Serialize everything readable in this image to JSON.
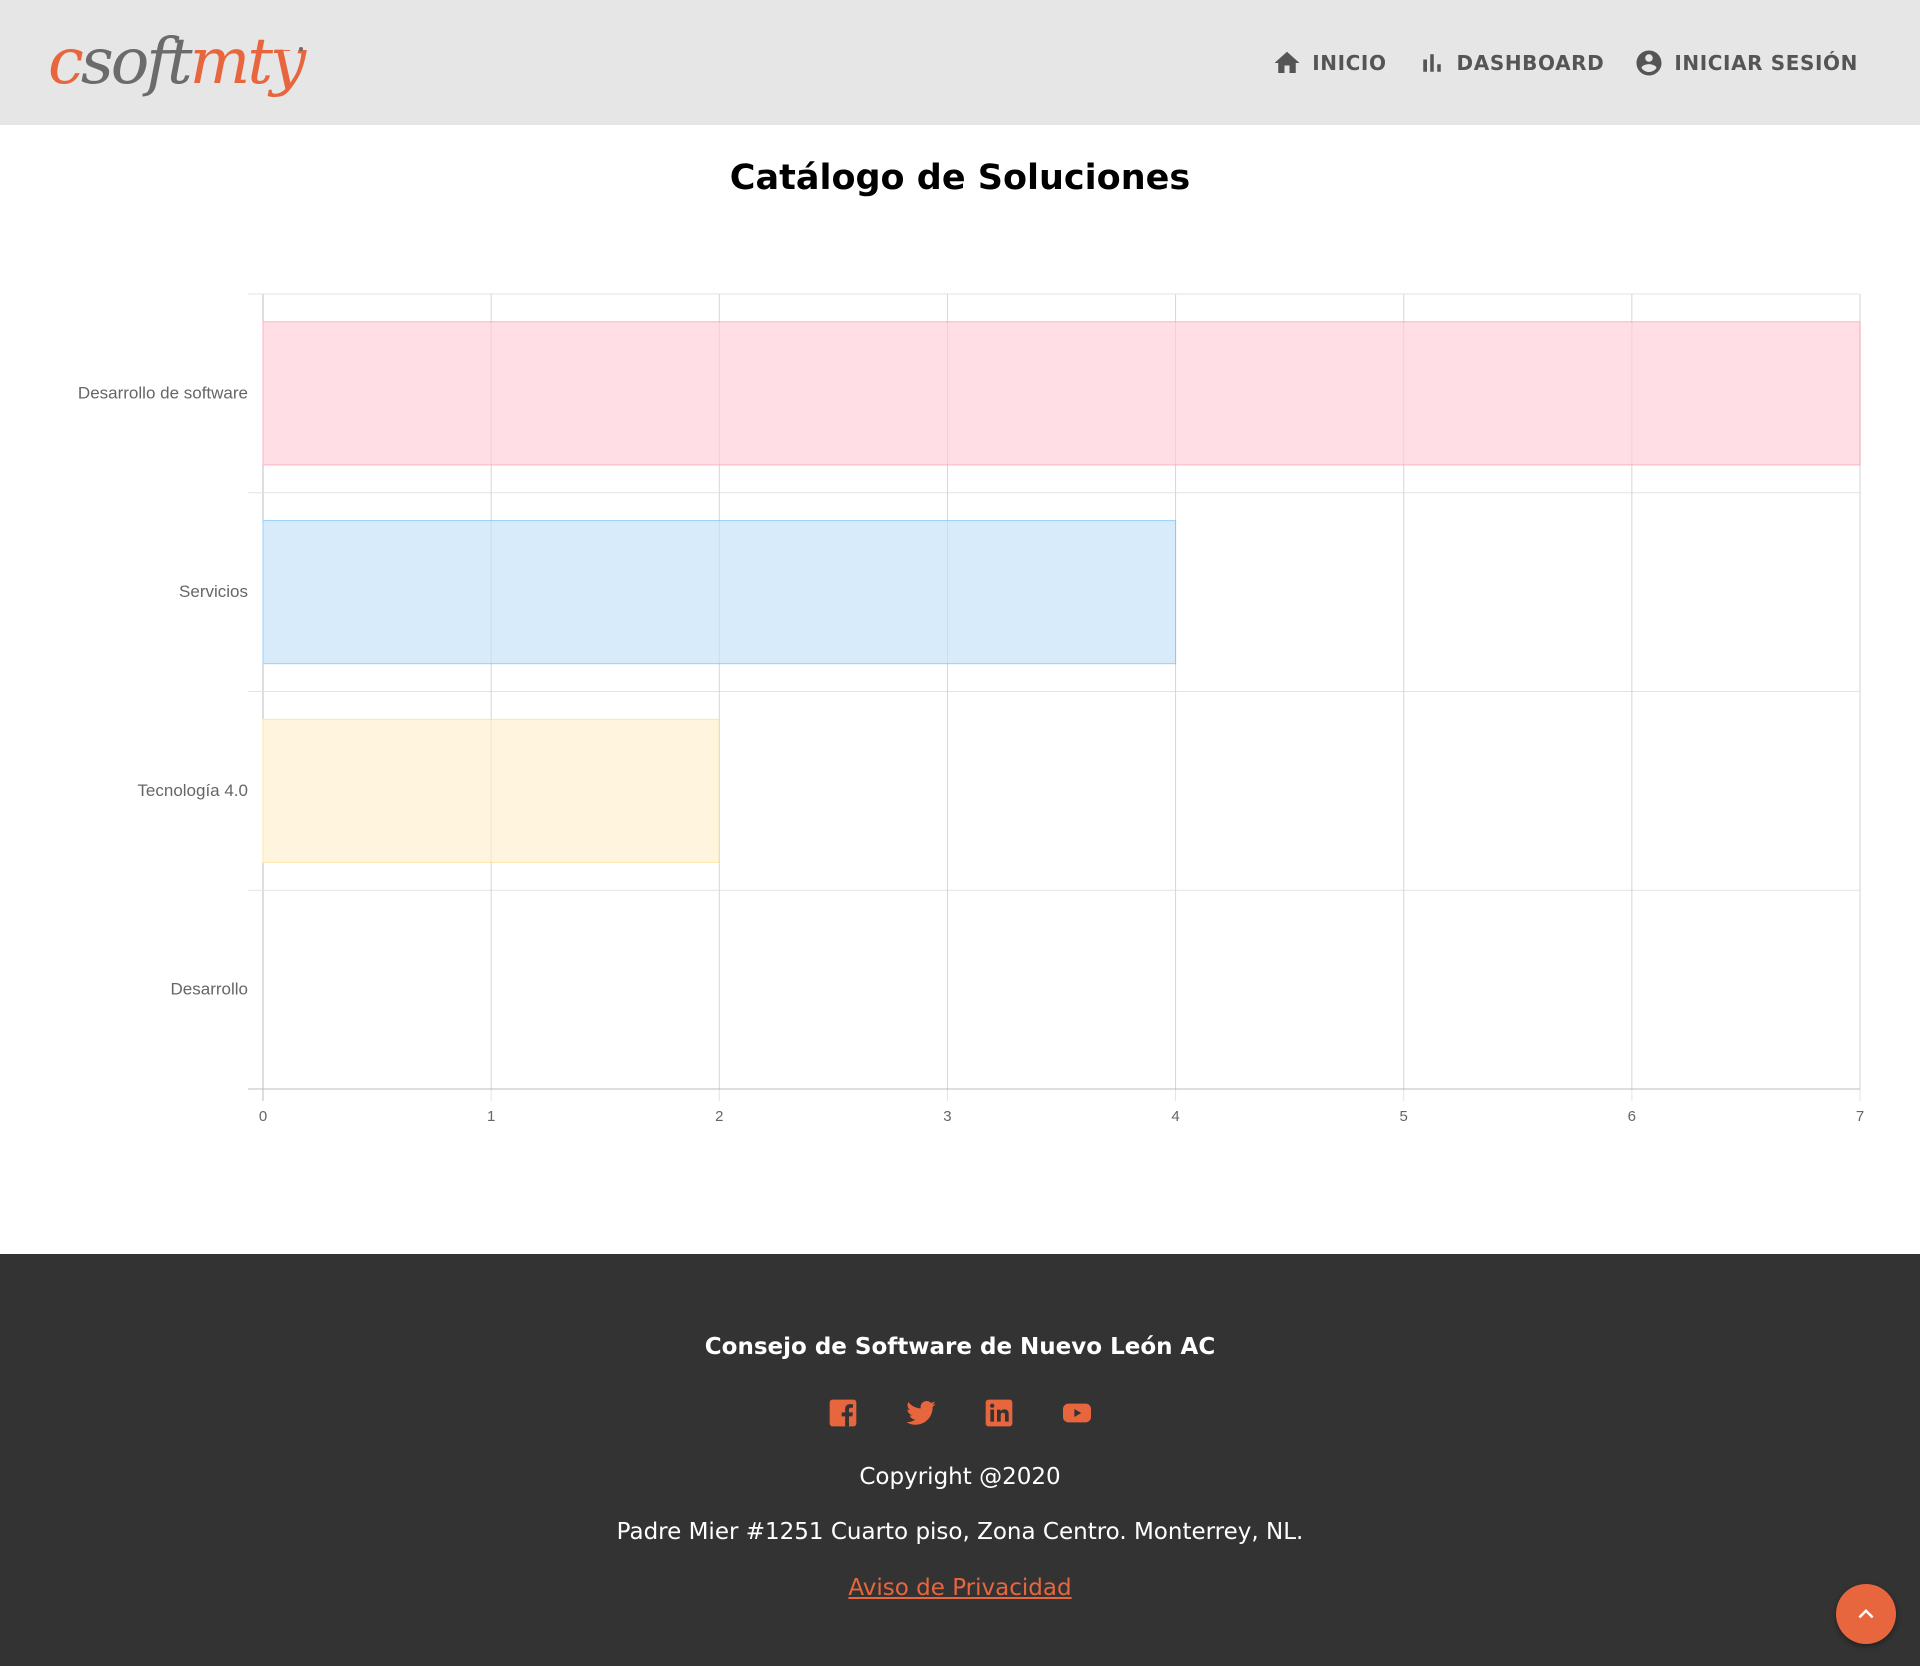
{
  "header": {
    "logo": {
      "c": "c",
      "soft": "soft",
      "mty": "mty"
    },
    "nav": [
      {
        "label": "INICIO",
        "icon": "home-icon"
      },
      {
        "label": "DASHBOARD",
        "icon": "bar-chart-icon"
      },
      {
        "label": "INICIAR SESIÓN",
        "icon": "account-circle-icon"
      }
    ]
  },
  "main": {
    "title": "Catálogo de Soluciones"
  },
  "chart_data": {
    "type": "bar",
    "orientation": "horizontal",
    "categories": [
      "Desarrollo de software",
      "Servicios",
      "Tecnología 4.0",
      "Desarrollo"
    ],
    "values": [
      7,
      4,
      2,
      0
    ],
    "colors": [
      "#ffdee5",
      "#d7ebfa",
      "#fff4dd",
      "#e6f7f7"
    ],
    "border_colors": [
      "#ffb1c1",
      "#9ad0f5",
      "#ffe6aa",
      "#a4dfdf"
    ],
    "xlim": [
      0,
      7
    ],
    "xticks": [
      "0",
      "1",
      "2",
      "3",
      "4",
      "5",
      "6",
      "7"
    ],
    "title": "",
    "xlabel": "",
    "ylabel": "",
    "grid": true,
    "legend": "none"
  },
  "footer": {
    "org": "Consejo de Software de Nuevo León AC",
    "socials": [
      "facebook-icon",
      "twitter-icon",
      "linkedin-icon",
      "youtube-icon"
    ],
    "copyright": "Copyright @2020",
    "address": "Padre Mier #1251 Cuarto piso, Zona Centro. Monterrey, NL.",
    "privacy": "Aviso de Privacidad"
  },
  "colors": {
    "accent": "#e8663d",
    "header_bg": "#e6e6e6",
    "footer_bg": "#333333"
  }
}
